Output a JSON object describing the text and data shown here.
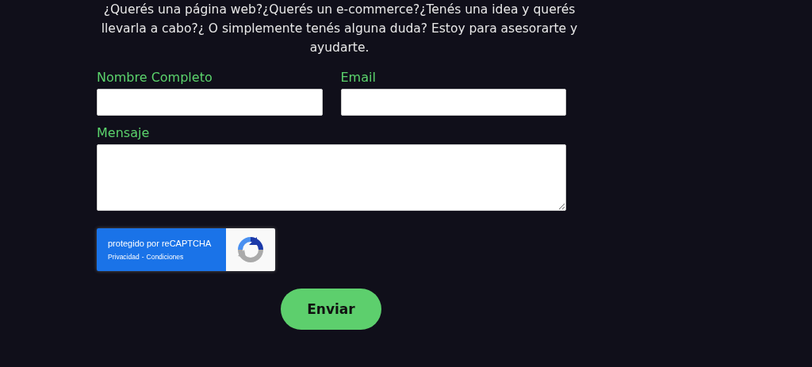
{
  "intro": "¿Querés una página web?¿Querés un e-commerce?¿Tenés una idea y querés llevarla a cabo?¿ O simplemente tenés alguna duda? Estoy para asesorarte y ayudarte.",
  "fields": [
    {
      "label": "Nombre Completo",
      "kind": "text"
    },
    {
      "label": "Email",
      "kind": "email"
    },
    {
      "label": "Mensaje",
      "kind": "textarea"
    }
  ],
  "recaptcha": {
    "title": "protegido por reCAPTCHA",
    "links": [
      "Privacidad",
      "Condiciones"
    ],
    "separator": "-"
  },
  "submit": "Enviar"
}
